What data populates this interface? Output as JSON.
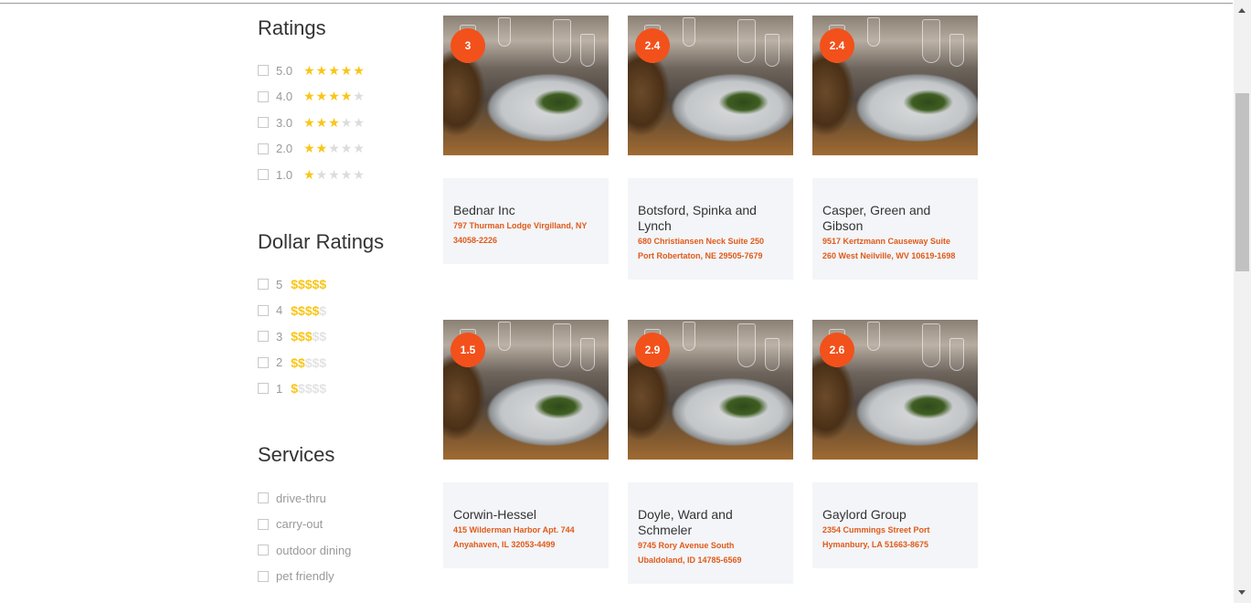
{
  "filters": {
    "ratings": {
      "title": "Ratings",
      "options": [
        {
          "label": "5.0",
          "stars": 5
        },
        {
          "label": "4.0",
          "stars": 4
        },
        {
          "label": "3.0",
          "stars": 3
        },
        {
          "label": "2.0",
          "stars": 2
        },
        {
          "label": "1.0",
          "stars": 1
        }
      ]
    },
    "dollar_ratings": {
      "title": "Dollar Ratings",
      "options": [
        {
          "label": "5",
          "dollars": 5
        },
        {
          "label": "4",
          "dollars": 4
        },
        {
          "label": "3",
          "dollars": 3
        },
        {
          "label": "2",
          "dollars": 2
        },
        {
          "label": "1",
          "dollars": 1
        }
      ]
    },
    "services": {
      "title": "Services",
      "options": [
        {
          "label": "drive-thru"
        },
        {
          "label": "carry-out"
        },
        {
          "label": "outdoor dining"
        },
        {
          "label": "pet friendly"
        }
      ]
    }
  },
  "restaurants": [
    {
      "rating": "3",
      "name": "Bednar Inc",
      "address": "797 Thurman Lodge Virgilland, NY 34058-2226"
    },
    {
      "rating": "2.4",
      "name": "Botsford, Spinka and Lynch",
      "address": "680 Christiansen Neck Suite 250 Port Robertaton, NE 29505-7679"
    },
    {
      "rating": "2.4",
      "name": "Casper, Green and Gibson",
      "address": "9517 Kertzmann Causeway Suite 260 West Neilville, WV 10619-1698"
    },
    {
      "rating": "1.5",
      "name": "Corwin-Hessel",
      "address": "415 Wilderman Harbor Apt. 744 Anyahaven, IL 32053-4499"
    },
    {
      "rating": "2.9",
      "name": "Doyle, Ward and Schmeler",
      "address": "9745 Rory Avenue South Ubaldoland, ID 14785-6569"
    },
    {
      "rating": "2.6",
      "name": "Gaylord Group",
      "address": "2354 Cummings Street Port Hymanbury, LA 51663-8675"
    }
  ],
  "colors": {
    "accent": "#f2511b",
    "address_text": "#e05a1a",
    "star_on": "#f9c516",
    "star_off": "#dcdcdc",
    "card_bg": "#f3f5f8"
  },
  "icons": {
    "star": "star-icon",
    "dollar": "dollar-icon",
    "checkbox": "checkbox-icon"
  }
}
